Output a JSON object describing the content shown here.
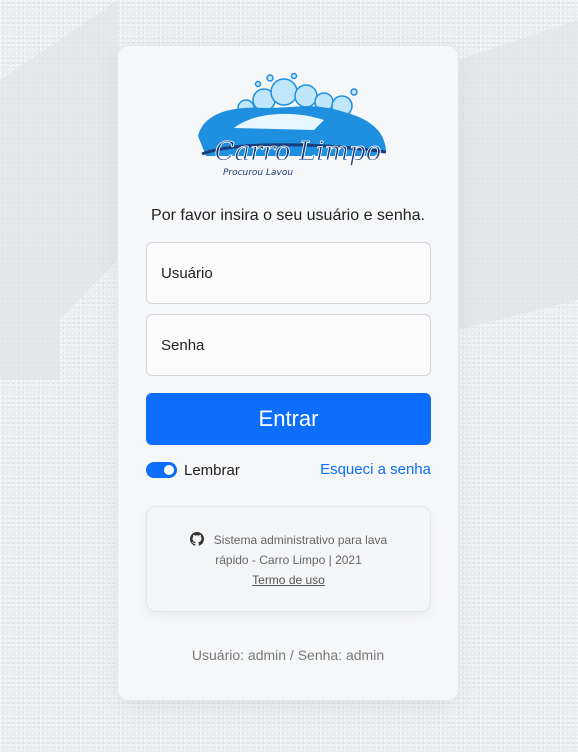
{
  "logo": {
    "brand": "Carro Limpo",
    "tagline": "Procurou Lavou"
  },
  "login": {
    "prompt": "Por favor insira o seu usuário e senha.",
    "username_placeholder": "Usuário",
    "password_placeholder": "Senha",
    "submit_label": "Entrar",
    "remember_label": "Lembrar",
    "remember_checked": true,
    "forgot_label": "Esqueci a senha"
  },
  "footer_box": {
    "line1": "Sistema administrativo para lava",
    "line2": "rápido - Carro Limpo | 2021",
    "terms_label": "Termo de uso"
  },
  "credentials_hint": "Usuário: admin / Senha: admin",
  "colors": {
    "accent": "#0d6efd",
    "logo_blue": "#1f8fdf",
    "logo_dark": "#1b3d7a"
  },
  "icons": {
    "footer": "github-icon"
  }
}
